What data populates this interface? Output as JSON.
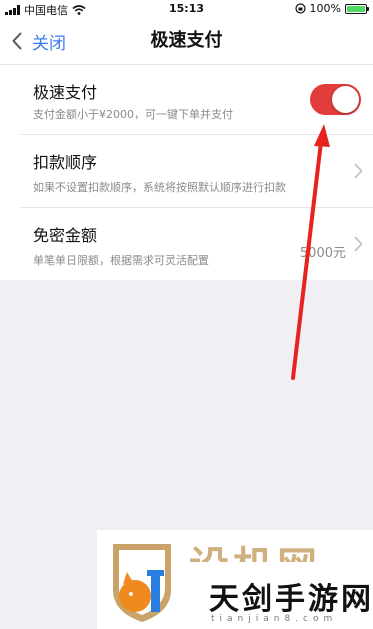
{
  "status_bar": {
    "carrier": "中国电信",
    "time": "15:13",
    "battery_percent": "100%",
    "battery_level": 1.0
  },
  "nav": {
    "back_label": "关闭",
    "title": "极速支付"
  },
  "settings": {
    "fast_pay": {
      "title": "极速支付",
      "subtitle": "支付金额小于¥2000，可一键下单并支付",
      "enabled": true
    },
    "deduction_order": {
      "title": "扣款顺序",
      "subtitle": "如果不设置扣款顺序，系统将按照默认顺序进行扣款"
    },
    "password_free_amount": {
      "title": "免密金额",
      "subtitle": "单笔单日限额，根据需求可灵活配置",
      "value": "5000元"
    }
  },
  "colors": {
    "accent": "#3a7bf0",
    "toggle_on": "#e33c3c",
    "annotation_arrow": "#e8231f"
  },
  "watermark": {
    "text": "天剑手游网",
    "domain": "tianjian8.com"
  }
}
